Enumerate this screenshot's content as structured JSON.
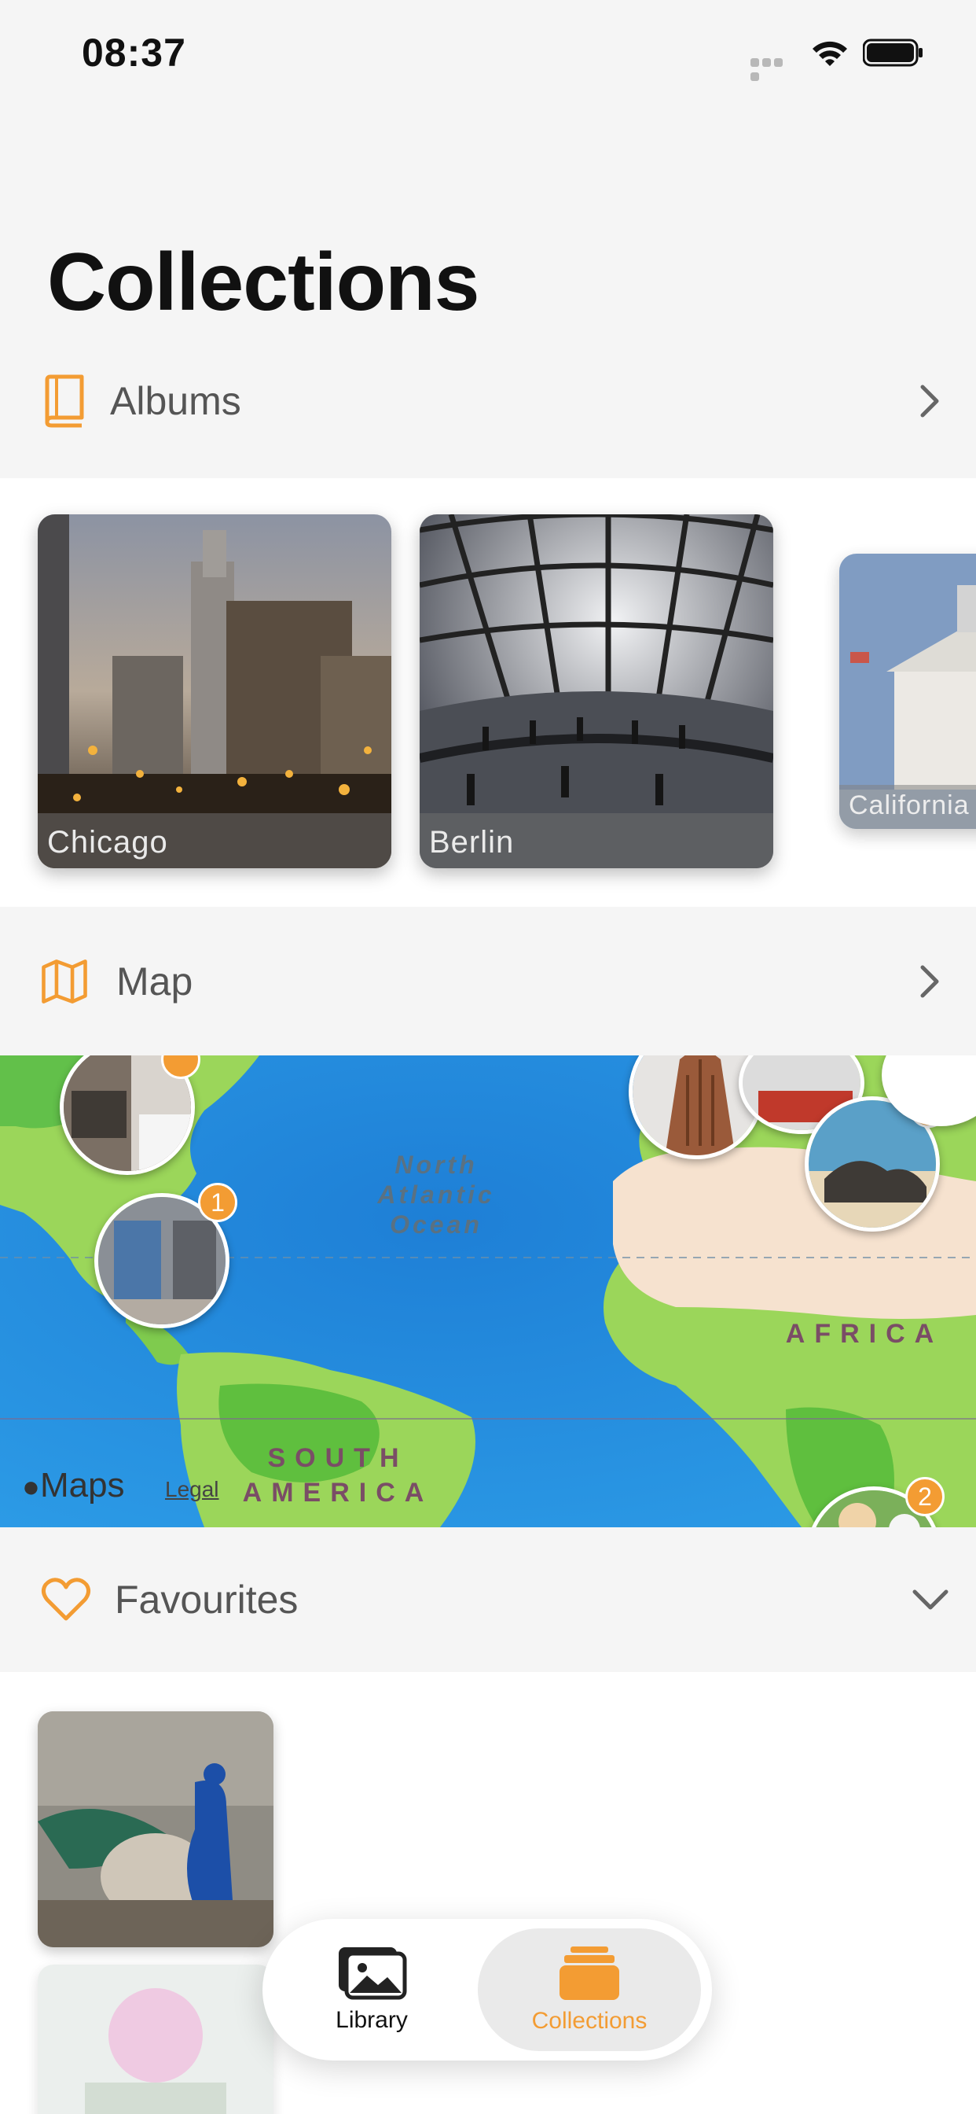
{
  "status": {
    "time": "08:37"
  },
  "title": "Collections",
  "sections": {
    "albums": {
      "label": "Albums",
      "icon": "book-icon"
    },
    "map": {
      "label": "Map",
      "icon": "map-icon"
    },
    "favourites": {
      "label": "Favourites",
      "icon": "heart-icon"
    }
  },
  "albums": [
    {
      "name": "Chicago"
    },
    {
      "name": "Berlin"
    },
    {
      "name": "California"
    }
  ],
  "map": {
    "ocean_label": "North\nAtlantic\nOcean",
    "africa_label": "AFRICA",
    "south_america_label": "SOUTH\nAMERICA",
    "attribution": "Maps",
    "legal": "Legal",
    "badges": [
      "1",
      "1",
      "2"
    ]
  },
  "tabs": [
    {
      "label": "Library",
      "active": false
    },
    {
      "label": "Collections",
      "active": true
    }
  ],
  "colors": {
    "accent": "#f39c33",
    "background": "#f5f5f5"
  }
}
